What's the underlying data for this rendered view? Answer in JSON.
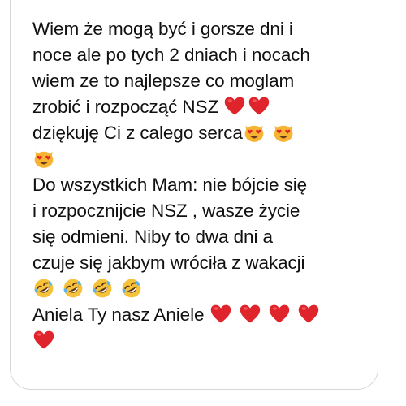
{
  "message": {
    "lines": [
      "Wiem że mogą być i gorsze dni i",
      "noce ale po tych 2 dniach i nocach",
      "wiem ze to najlepsze co moglam",
      "zrobić i rozpocząć NSZ",
      "dziękuję Ci z calego serca",
      "",
      "Do wszystkich Mam: nie bójcie się",
      "i rozpocznijcie NSZ , wasze życie",
      "się odmieni.  Niby to dwa dni a",
      "czuje się jakbym wróciła z wakacji",
      "",
      "Aniela Ty nasz Aniele"
    ],
    "emojis": {
      "line4": [
        "heart-icon",
        "heart-icon"
      ],
      "line5": [
        "heart-eyes-cat-icon",
        "heart-eyes-cat-icon"
      ],
      "line6": [
        "heart-eyes-cat-icon"
      ],
      "line11": [
        "rolling-laughing-icon",
        "rolling-laughing-icon",
        "rolling-laughing-icon",
        "rolling-laughing-icon"
      ],
      "line12": [
        "heart-icon",
        "heart-icon",
        "heart-icon",
        "heart-icon"
      ],
      "line13": [
        "heart-icon"
      ]
    }
  },
  "colors": {
    "text": "#111111",
    "heart": "#e0242c",
    "cat_face": "#f6b432",
    "bubble_border": "#d7d7d7"
  }
}
